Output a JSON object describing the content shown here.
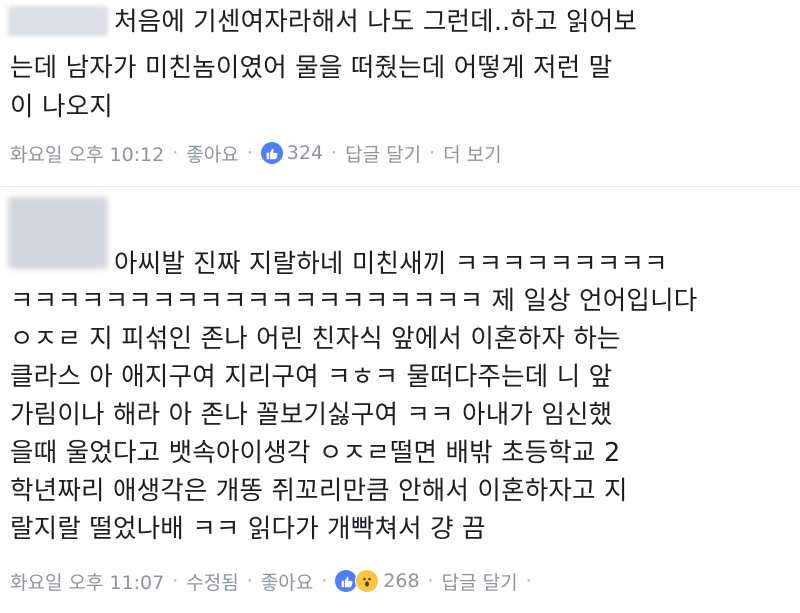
{
  "comments": [
    {
      "lines": [
        "처음에 기센여자라해서 나도 그런데..하고 읽어보",
        "는데 남자가 미친놈이였어 물을 떠줬는데 어떻게 저런 말",
        "이 나오지"
      ],
      "meta": {
        "time": "화요일 오후 10:12",
        "like": "좋아요",
        "count": "324",
        "reply": "답글 달기",
        "more": "더 보기"
      }
    },
    {
      "lines": [
        "아씨발 진짜 지랄하네 미친새끼 ㅋㅋㅋㅋㅋㅋㅋㅋㅋ",
        "ㅋㅋㅋㅋㅋㅋㅋㅋㅋㅋㅋㅋㅋㅋㅋㅋㅋㅋㅋㅋ 제 일상 언어입니다",
        "ㅇㅈㄹ 지 피섞인 존나 어린 친자식 앞에서 이혼하자 하는",
        "클라스 아 애지구여 지리구여 ㅋㅎㅋ 물떠다주는데 니 앞",
        "가림이나 해라 아 존나 꼴보기싫구여 ㅋㅋ 아내가 임신했",
        "을때 울었다고 뱃속아이생각 ㅇㅈㄹ떨면 배밖 초등학교 2",
        "학년짜리 애생각은 개똥 쥐꼬리만큼 안해서 이혼하자고 지",
        "랄지랄 떨었나배 ㅋㅋ 읽다가 개빡쳐서 걍 끔"
      ],
      "meta": {
        "time": "화요일 오후 11:07",
        "edited": "수정됨",
        "like": "좋아요",
        "count": "268",
        "reply": "답글 달기"
      }
    }
  ],
  "colors": {
    "text": "#1c1e21",
    "meta": "#90949c",
    "like_blue": "#4c7ef5",
    "wow_yellow": "#f7c744"
  }
}
